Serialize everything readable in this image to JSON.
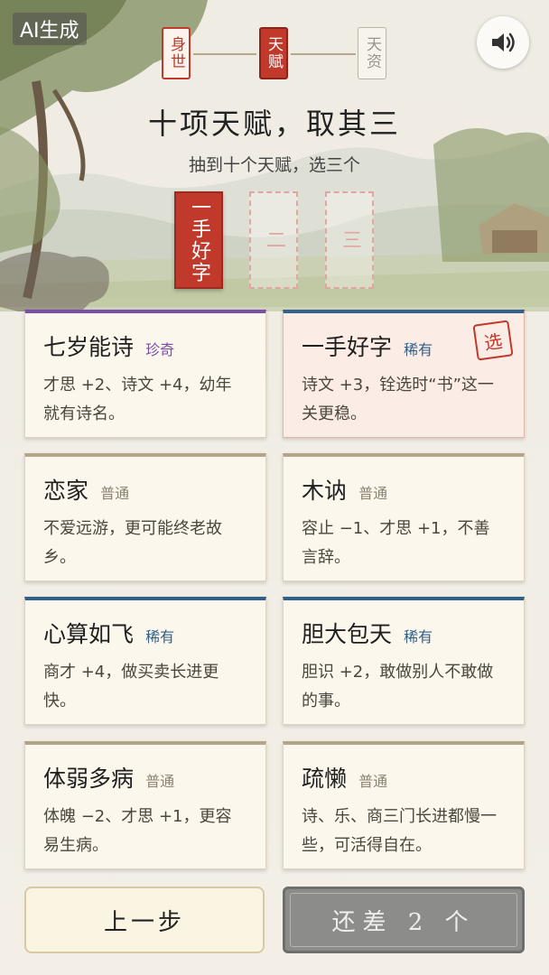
{
  "badge": "AI生成",
  "steps": [
    {
      "label": "身世",
      "state": "done"
    },
    {
      "label": "天赋",
      "state": "current"
    },
    {
      "label": "天资",
      "state": "future"
    }
  ],
  "sound_icon": "speaker-volume-icon",
  "title": "十项天赋，取其三",
  "subtitle": "抽到十个天赋，选三个",
  "slots": [
    "一手好字",
    "二",
    "三"
  ],
  "cards": [
    {
      "name": "七岁能诗",
      "rarity": "珍奇",
      "rarity_color": "#7b4ea8",
      "desc": "才思 +2、诗文 +4，幼年就有诗名。",
      "selected": false
    },
    {
      "name": "一手好字",
      "rarity": "稀有",
      "rarity_color": "#2f5f8a",
      "desc": "诗文 +3，铨选时“书”这一关更稳。",
      "selected": true,
      "stamp": "选"
    },
    {
      "name": "恋家",
      "rarity": "普通",
      "rarity_color": "#8a8171",
      "desc": "不爱远游，更可能终老故乡。",
      "selected": false
    },
    {
      "name": "木讷",
      "rarity": "普通",
      "rarity_color": "#8a8171",
      "desc": "容止 −1、才思 +1，不善言辞。",
      "selected": false
    },
    {
      "name": "心算如飞",
      "rarity": "稀有",
      "rarity_color": "#2f5f8a",
      "desc": "商才 +4，做买卖长进更快。",
      "selected": false
    },
    {
      "name": "胆大包天",
      "rarity": "稀有",
      "rarity_color": "#2f5f8a",
      "desc": "胆识 +2，敢做别人不敢做的事。",
      "selected": false
    },
    {
      "name": "体弱多病",
      "rarity": "普通",
      "rarity_color": "#8a8171",
      "desc": "体魄 −2、才思 +1，更容易生病。",
      "selected": false
    },
    {
      "name": "疏懒",
      "rarity": "普通",
      "rarity_color": "#8a8171",
      "desc": "诗、乐、商三门长进都慢一些，可活得自在。",
      "selected": false
    }
  ],
  "buttons": {
    "back": "上一步",
    "confirm": "还差 2 个"
  },
  "colors": {
    "accent_red": "#c0392b",
    "rare_blue": "#2f5f8a",
    "epic_purple": "#7b4ea8",
    "common_tan": "#8a8171"
  }
}
